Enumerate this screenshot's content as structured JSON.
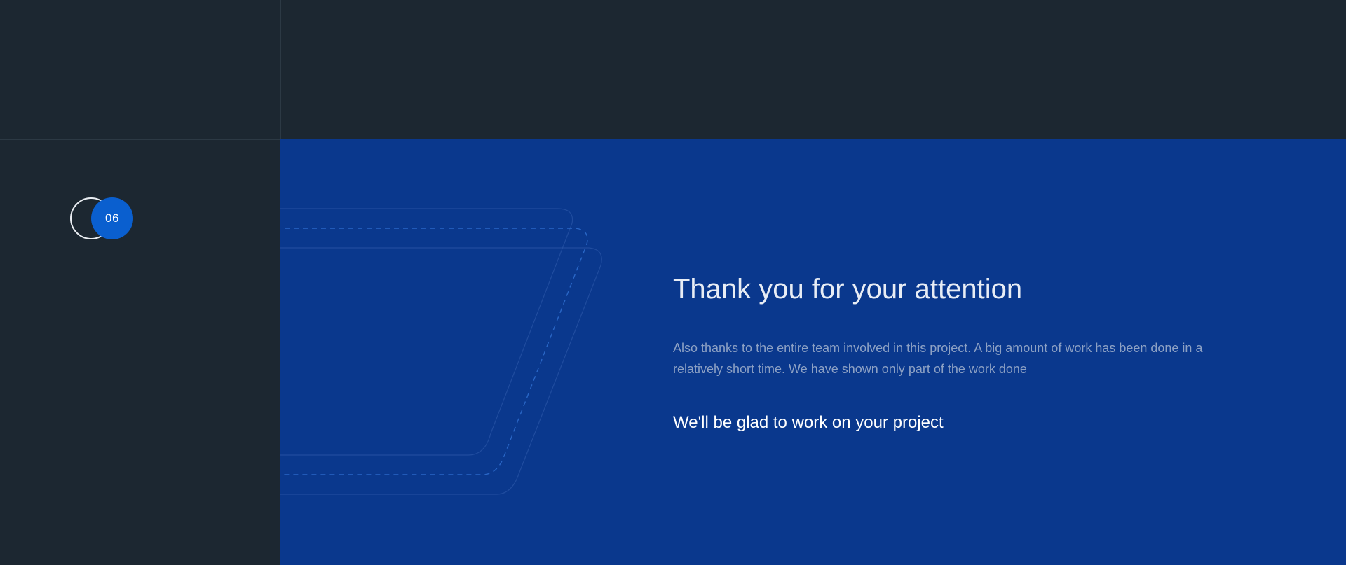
{
  "slide": {
    "number": "06",
    "title": "Thank you for your attention",
    "description": "Also thanks to the entire team involved in this project. A big amount of work has been done in a relatively short time. We have shown only part of the work done",
    "tagline": "We'll be glad to work on your project"
  },
  "colors": {
    "background": "#1c2731",
    "panel": "#0a388d",
    "accent": "#0a5fcf",
    "text_light": "#e8edf5",
    "text_muted": "#8da1c4"
  }
}
